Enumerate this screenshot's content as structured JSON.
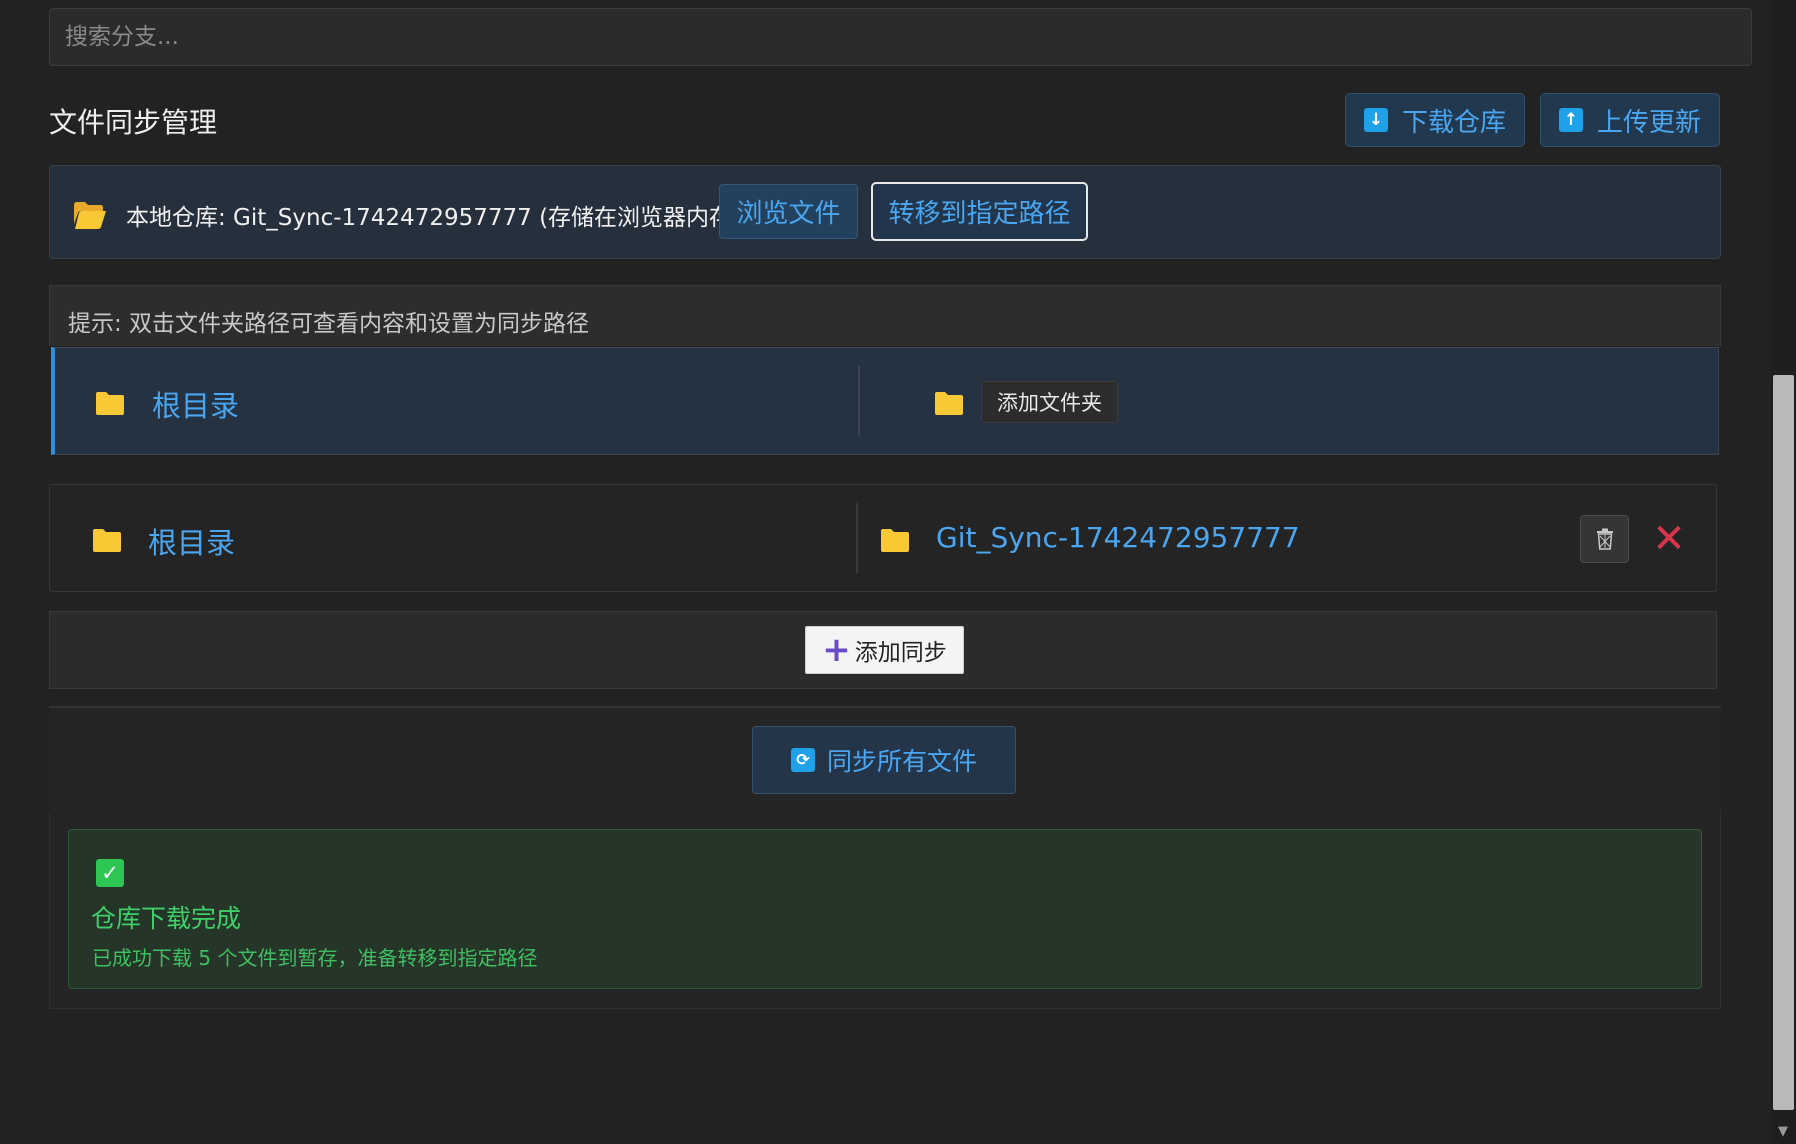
{
  "search": {
    "placeholder": "搜索分支..."
  },
  "header": {
    "title": "文件同步管理",
    "download_label": "下载仓库",
    "upload_label": "上传更新"
  },
  "repo": {
    "text": "本地仓库: Git_Sync-1742472957777 (存储在浏览器内存中)",
    "browse_label": "浏览文件",
    "move_label": "转移到指定路径"
  },
  "hint": "提示: 双击文件夹路径可查看内容和设置为同步路径",
  "rows": [
    {
      "source": "根目录",
      "add_folder_label": "添加文件夹"
    },
    {
      "source": "根目录",
      "target": "Git_Sync-1742472957777"
    }
  ],
  "add_sync_label": "添加同步",
  "sync_all_label": "同步所有文件",
  "status": {
    "title": "仓库下载完成",
    "message": "已成功下载 5 个文件到暂存，准备转移到指定路径"
  },
  "colors": {
    "accent": "#4aa6f0",
    "success": "#3fd06a",
    "danger": "#d8344d",
    "folder": "#f9c935"
  }
}
